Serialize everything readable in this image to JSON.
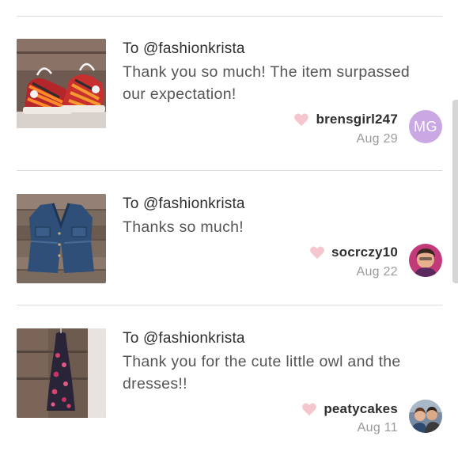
{
  "notes": [
    {
      "to": "To @fashionkrista",
      "message": "Thank you so much! The item surpassed our expectation!",
      "username": "brensgirl247",
      "date": "Aug 29",
      "avatar_initials": "MG",
      "item_image": "converse-sneakers",
      "avatar_kind": "initials"
    },
    {
      "to": "To @fashionkrista",
      "message": "Thanks so much!",
      "username": "socrczy10",
      "date": "Aug 22",
      "item_image": "denim-vest",
      "avatar_kind": "photo"
    },
    {
      "to": "To @fashionkrista",
      "message": "Thank you for the cute little owl and the dresses!!",
      "username": "peatycakes",
      "date": "Aug 11",
      "item_image": "floral-maxi-dress",
      "avatar_kind": "photo"
    }
  ],
  "icons": {
    "like": "heart-icon"
  },
  "colors": {
    "heart": "#f6c6cf",
    "avatar_initials_bg": "#c9a8e4",
    "divider": "#dcdcdc"
  }
}
